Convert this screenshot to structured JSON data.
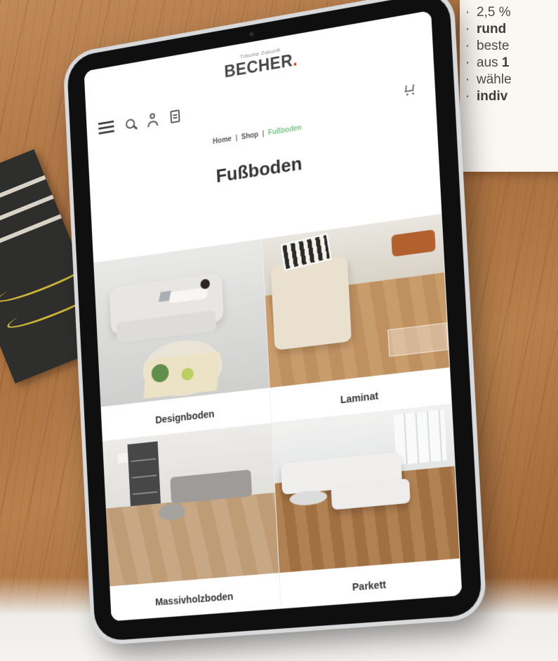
{
  "background_card": {
    "items": [
      {
        "pre": "2,5 %",
        "bold": "",
        "post": ""
      },
      {
        "pre": "",
        "bold": "rund",
        "post": ""
      },
      {
        "pre": "beste",
        "bold": "",
        "post": ""
      },
      {
        "pre": "aus ",
        "bold": "1",
        "post": ""
      },
      {
        "pre": "wähle",
        "bold": "",
        "post": ""
      },
      {
        "pre": "",
        "bold": "indiv",
        "post": ""
      }
    ]
  },
  "header": {
    "brand_tagline": "Träume Zukunft",
    "brand_name": "BECHER",
    "brand_dot": "."
  },
  "breadcrumb": {
    "home": "Home",
    "shop": "Shop",
    "current": "Fußboden",
    "separator": "|"
  },
  "page_title": "Fußboden",
  "categories": [
    {
      "label": "Designboden"
    },
    {
      "label": "Laminat"
    },
    {
      "label": "Massivholzboden"
    },
    {
      "label": "Parkett"
    }
  ],
  "colors": {
    "accent_green": "#7cc48a",
    "brand_red": "#e2261c"
  },
  "icons": [
    "menu-icon",
    "search-icon",
    "user-icon",
    "wishlist-icon",
    "cart-icon"
  ]
}
